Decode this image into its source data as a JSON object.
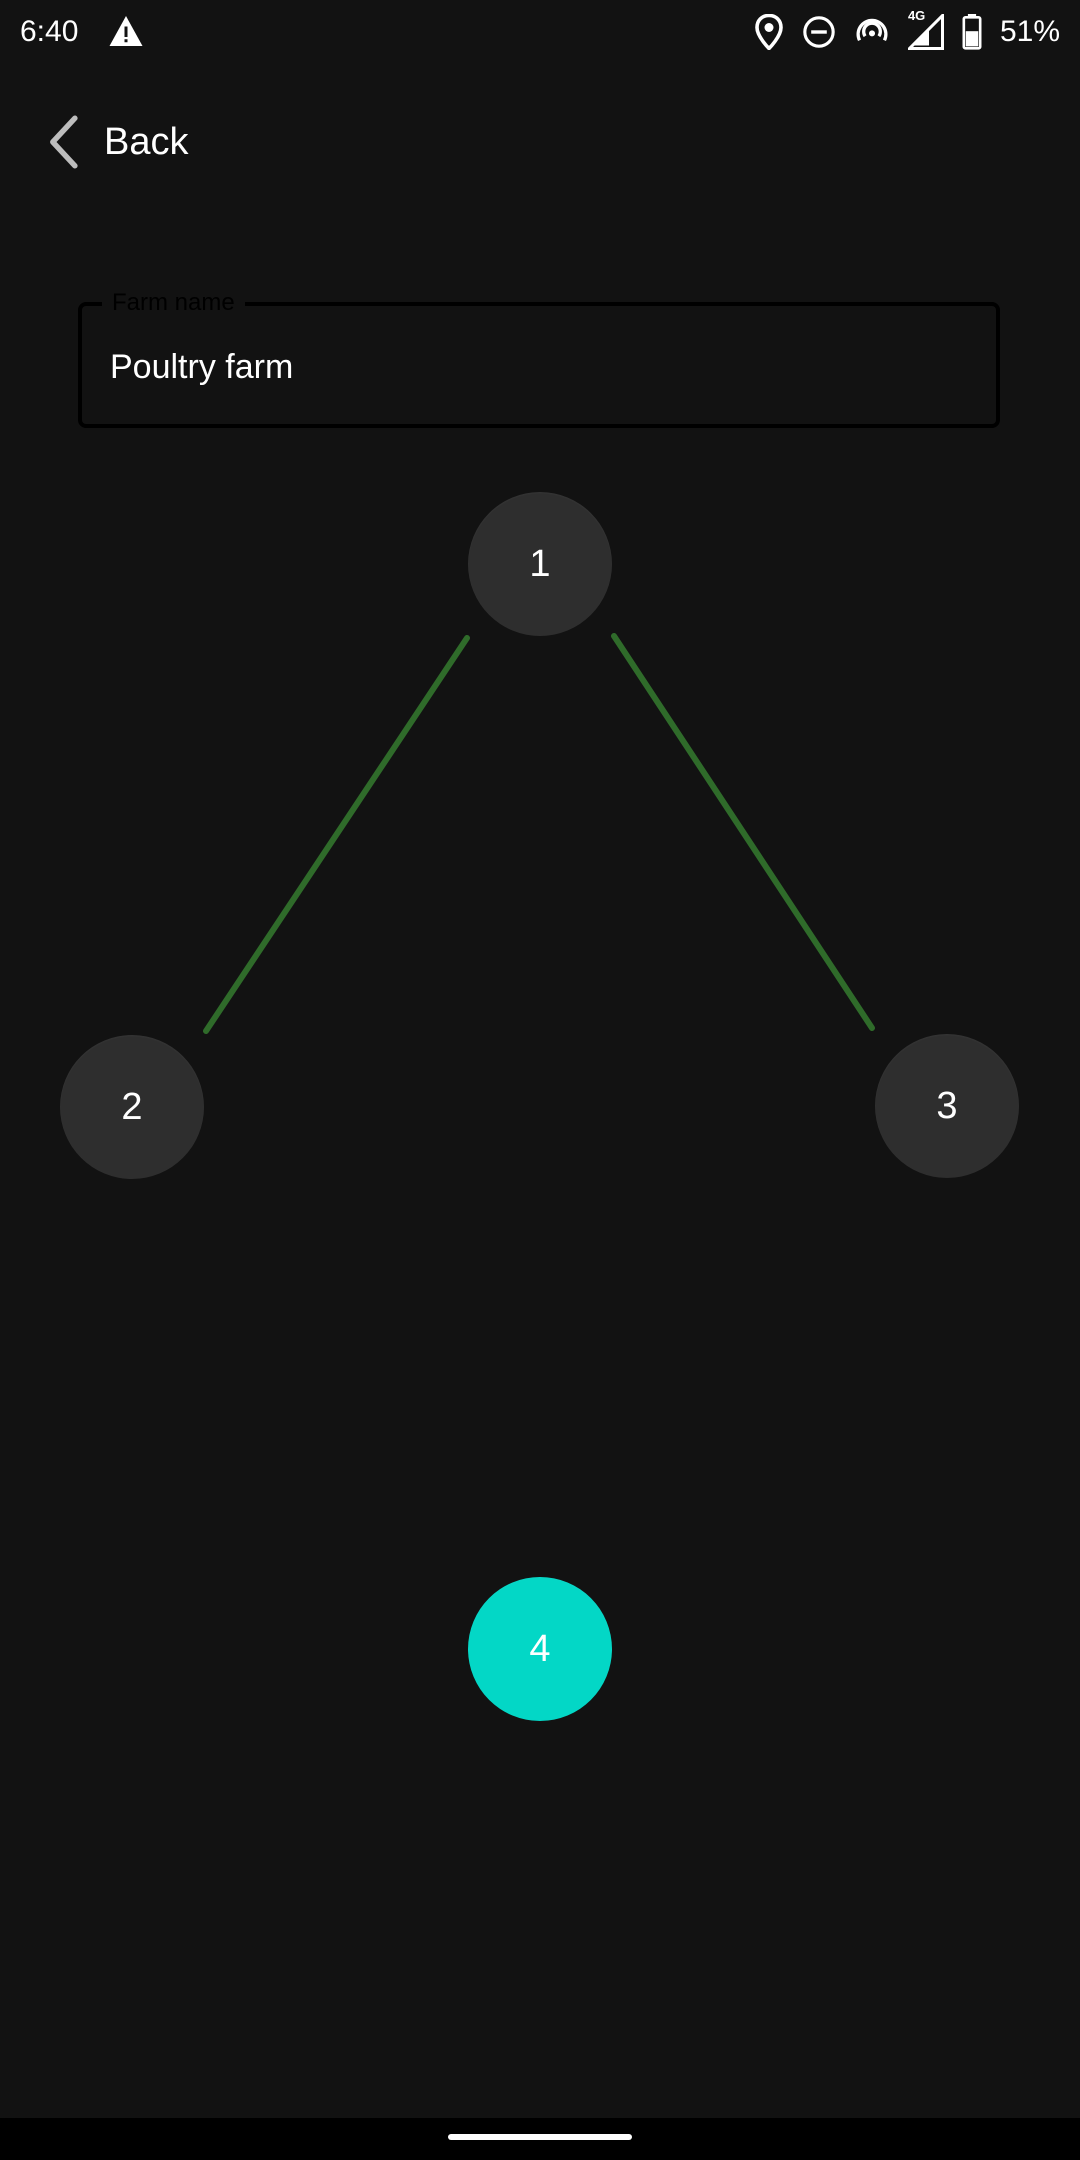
{
  "status_bar": {
    "time": "6:40",
    "battery_percent": "51%",
    "network_label": "4G"
  },
  "header": {
    "back_label": "Back"
  },
  "form": {
    "farm_name_label": "Farm name",
    "farm_name_value": "Poultry farm"
  },
  "graph": {
    "nodes": [
      {
        "label": "1",
        "active": false
      },
      {
        "label": "2",
        "active": false
      },
      {
        "label": "3",
        "active": false
      },
      {
        "label": "4",
        "active": true
      }
    ],
    "edges": [
      {
        "from": "1",
        "to": "2"
      },
      {
        "from": "1",
        "to": "3"
      }
    ],
    "colors": {
      "edge": "#2f6b2a",
      "node": "#2e2e2e",
      "node_active": "#03d7c6"
    }
  }
}
